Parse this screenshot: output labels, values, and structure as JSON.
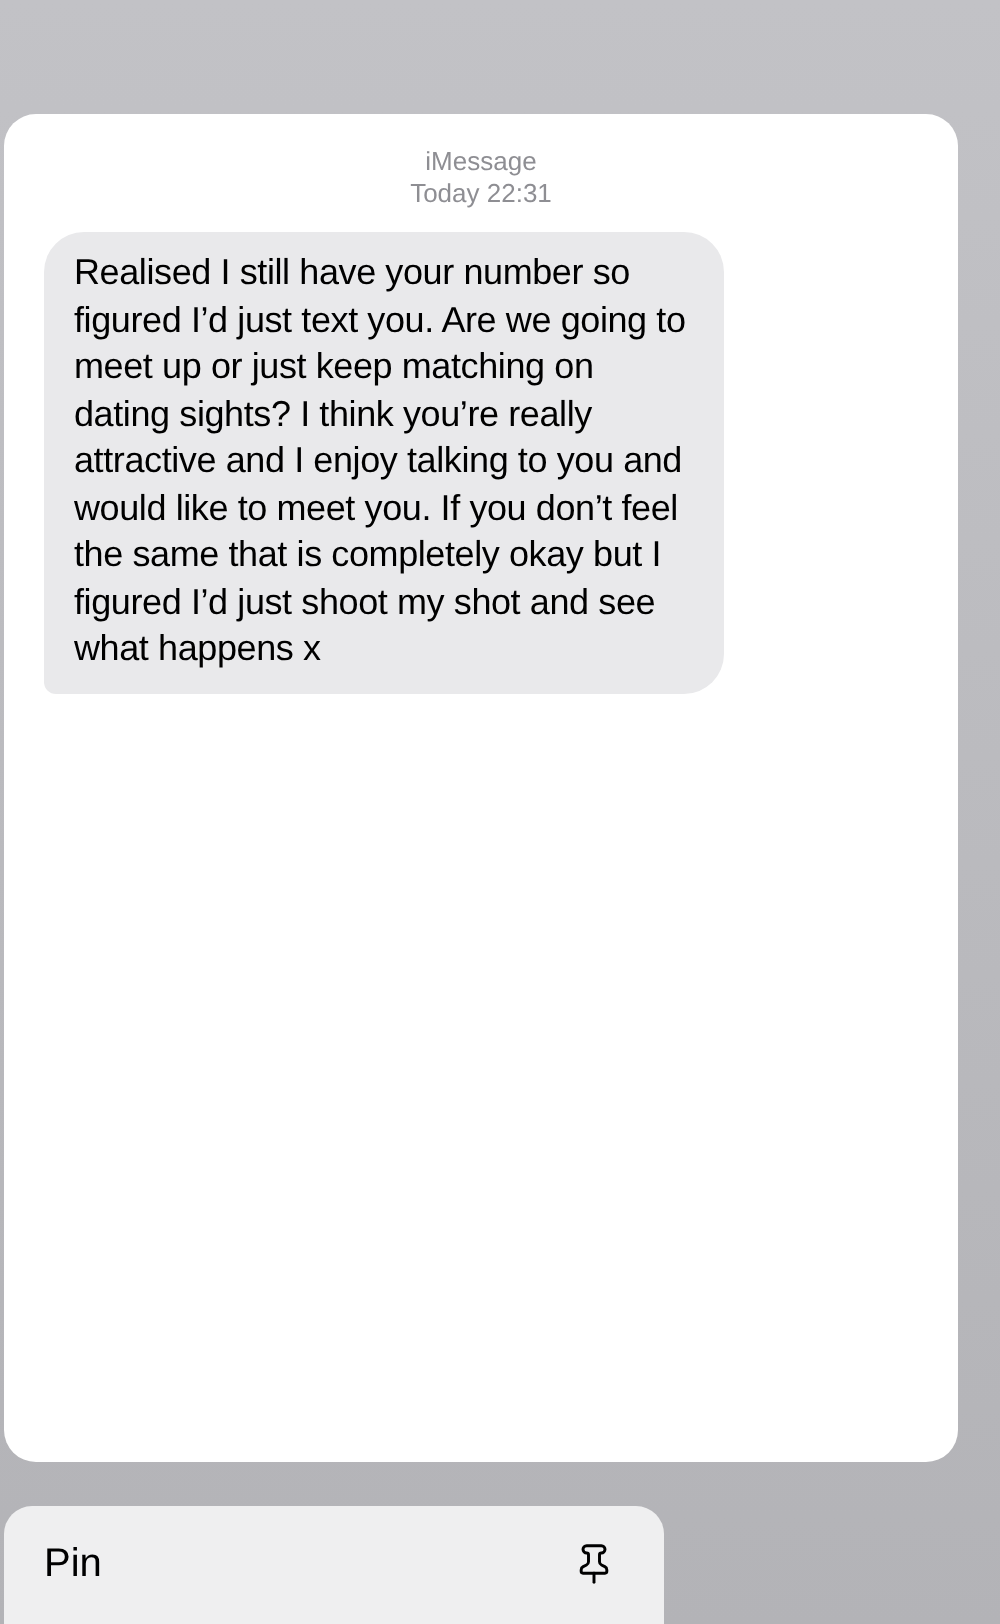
{
  "header": {
    "service": "iMessage",
    "timestamp": "Today 22:31"
  },
  "messages": [
    {
      "kind": "incoming",
      "text": "Realised I still have your number so figured I’d just text you. Are we going to meet up or just keep matching on dating sights? I think you’re really attractive and I enjoy talking to you and would like to meet you. If you don’t feel the same that is completely okay but I figured I’d just shoot my shot and see what happens x"
    }
  ],
  "menu": [
    {
      "label": "Pin"
    }
  ]
}
